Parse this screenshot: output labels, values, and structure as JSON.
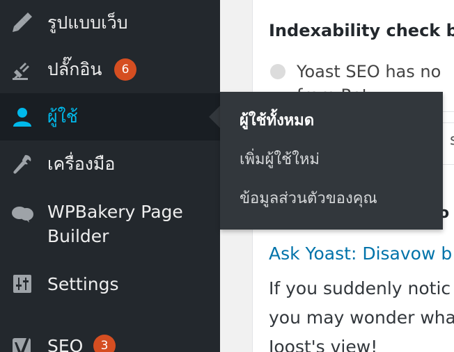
{
  "sidebar": {
    "items": [
      {
        "label": "รูปแบบเว็บ",
        "icon": "appearance-brush-icon"
      },
      {
        "label": "ปลั๊กอิน",
        "icon": "plugins-icon",
        "badge": "6"
      },
      {
        "label": "ผู้ใช้",
        "icon": "users-icon",
        "active": true
      },
      {
        "label": "เครื่องมือ",
        "icon": "tools-wrench-icon"
      },
      {
        "label": "WPBakery Page",
        "label2": "Builder",
        "icon": "wpbakery-cloud-icon"
      },
      {
        "label": "Settings",
        "icon": "settings-sliders-icon"
      },
      {
        "label": "SEO",
        "icon": "yoast-seo-icon",
        "badge": "3"
      }
    ]
  },
  "flyout": {
    "items": [
      {
        "label": "ผู้ใช้ทั้งหมด"
      },
      {
        "label": "เพิ่มผู้ใช้ใหม่"
      },
      {
        "label": "ข้อมูลส่วนตัวของคุณ"
      }
    ]
  },
  "content": {
    "indexability_title": "Indexability check b",
    "indexability_text": "Yoast SEO has no",
    "indexability_text2": "from Rot",
    "tab_stub": "sta",
    "news_heading_stub": "o",
    "article_link": "Ask Yoast: Disavow b",
    "article_lines": [
      "If you suddenly notic",
      "you may wonder wha",
      "Joost's view!"
    ]
  },
  "colors": {
    "sidebar_bg": "#23282d",
    "active_bg": "#191e23",
    "accent": "#00b9eb",
    "badge": "#d54e21",
    "flyout_bg": "#32373c",
    "link": "#0073aa"
  }
}
